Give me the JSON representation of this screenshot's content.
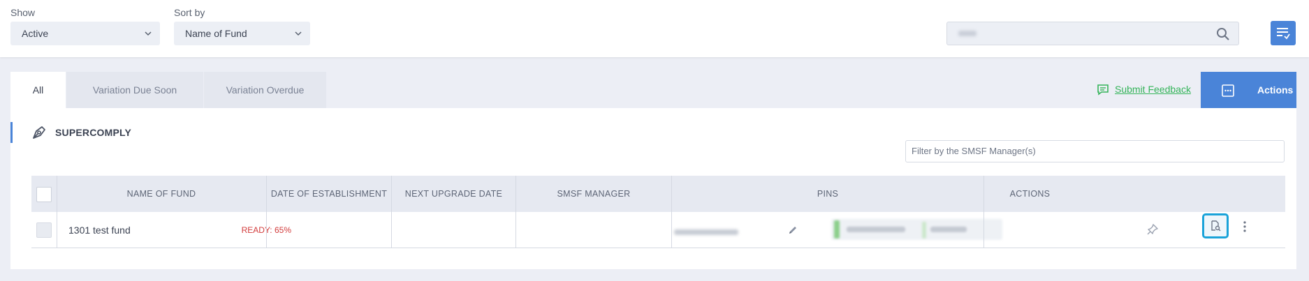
{
  "toolbar": {
    "show_label": "Show",
    "show_value": "Active",
    "sort_label": "Sort by",
    "sort_value": "Name of Fund",
    "search_placeholder": "",
    "search_icon": "search-icon",
    "list_settings_icon": "list-settings-icon"
  },
  "tabs": [
    {
      "label": "All",
      "active": true
    },
    {
      "label": "Variation Due Soon",
      "active": false
    },
    {
      "label": "Variation Overdue",
      "active": false
    }
  ],
  "feedback": {
    "label": "Submit Feedback",
    "icon": "chat-icon"
  },
  "actions_button": {
    "label": "Actions",
    "icon": "more-box-icon"
  },
  "section": {
    "title": "SUPERCOMPLY",
    "icon": "pen-nib-icon"
  },
  "filter": {
    "placeholder": "Filter by the SMSF Manager(s)"
  },
  "table": {
    "columns": [
      "NAME OF FUND",
      "DATE OF ESTABLISHMENT",
      "NEXT UPGRADE DATE",
      "SMSF MANAGER",
      "PINS",
      "ACTIONS"
    ],
    "rows": [
      {
        "fund_name": "1301 test fund",
        "status": "READY: 65%",
        "date_of_establishment": "",
        "next_upgrade_date": "",
        "smsf_manager": "",
        "pins": ""
      }
    ]
  },
  "colors": {
    "accent": "#4a84d8",
    "ready_red": "#d23b3b",
    "feedback_green": "#35b45a",
    "focus_ring": "#1aa3d9"
  }
}
